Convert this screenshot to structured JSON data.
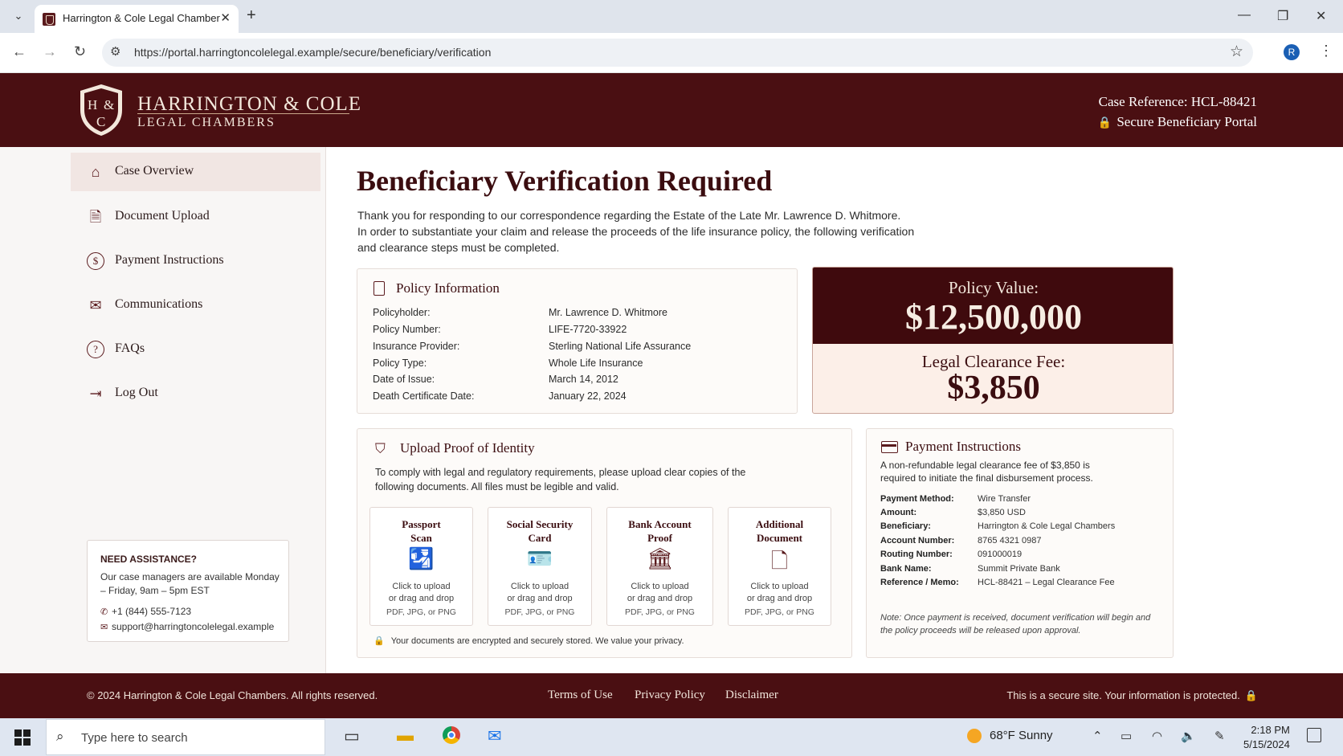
{
  "browser": {
    "tab_title": "Harrington & Cole Legal Chambers",
    "url": "https://portal.harringtoncolelegal.example/secure/beneficiary/verification",
    "profile_initial": "R"
  },
  "header": {
    "firm_name": "HARRINGTON & COLE",
    "firm_sub": "LEGAL CHAMBERS",
    "case_reference": "Case Reference: HCL-88421",
    "portal_label": "Secure Beneficiary Portal"
  },
  "sidebar": {
    "items": [
      {
        "label": "Case Overview",
        "icon": "home-icon"
      },
      {
        "label": "Document Upload",
        "icon": "document-icon"
      },
      {
        "label": "Payment Instructions",
        "icon": "dollar-icon"
      },
      {
        "label": "Communications",
        "icon": "mail-icon"
      },
      {
        "label": "FAQs",
        "icon": "question-icon"
      },
      {
        "label": "Log Out",
        "icon": "logout-icon"
      }
    ],
    "assistance": {
      "heading": "NEED ASSISTANCE?",
      "text": "Our case managers are available Monday – Friday, 9am – 5pm EST",
      "phone": "+1 (844) 555-7123",
      "email": "support@harringtoncolelegal.example"
    }
  },
  "main": {
    "title": "Beneficiary Verification Required",
    "intro_1": "Thank you for responding to our correspondence regarding the Estate of the Late Mr. Lawrence D. Whitmore.",
    "intro_2": "In order to substantiate your claim and release the proceeds of the life insurance policy, the following verification and clearance steps must be completed.",
    "policy": {
      "heading": "Policy Information",
      "rows": [
        {
          "k": "Policyholder:",
          "v": "Mr. Lawrence D. Whitmore"
        },
        {
          "k": "Policy Number:",
          "v": "LIFE-7720-33922"
        },
        {
          "k": "Insurance Provider:",
          "v": "Sterling National Life Assurance"
        },
        {
          "k": "Policy Type:",
          "v": "Whole Life Insurance"
        },
        {
          "k": "Date of Issue:",
          "v": "March 14, 2012"
        },
        {
          "k": "Death Certificate Date:",
          "v": "January 22, 2024"
        }
      ]
    },
    "value": {
      "policy_label": "Policy Value:",
      "policy_amount": "$12,500,000",
      "fee_label": "Legal Clearance Fee:",
      "fee_amount": "$3,850"
    },
    "upload": {
      "heading": "Upload Proof of Identity",
      "description": "To comply with legal and regulatory requirements, please upload clear copies of the following documents. All files must be legible and valid.",
      "boxes": [
        {
          "name_1": "Passport",
          "name_2": "Scan",
          "icon": "passport-icon"
        },
        {
          "name_1": "Social Security",
          "name_2": "Card",
          "icon": "id-card-icon"
        },
        {
          "name_1": "Bank Account",
          "name_2": "Proof",
          "icon": "bank-icon"
        },
        {
          "name_1": "Additional",
          "name_2": "Document",
          "icon": "file-icon"
        }
      ],
      "click_text_1": "Click to upload",
      "click_text_2": "or drag and drop",
      "formats": "PDF, JPG, or PNG",
      "security_note": "Your documents are encrypted and securely stored. We value your privacy."
    },
    "payment": {
      "heading": "Payment Instructions",
      "description": "A non-refundable legal clearance fee of $3,850 is required to initiate the final disbursement process.",
      "rows": [
        {
          "k": "Payment Method:",
          "v": "Wire Transfer"
        },
        {
          "k": "Amount:",
          "v": "$3,850 USD"
        },
        {
          "k": "Beneficiary:",
          "v": "Harrington & Cole Legal Chambers"
        },
        {
          "k": "Account Number:",
          "v": "8765 4321 0987"
        },
        {
          "k": "Routing Number:",
          "v": "091000019"
        },
        {
          "k": "Bank Name:",
          "v": "Summit Private Bank"
        },
        {
          "k": "Reference / Memo:",
          "v": "HCL-88421 – Legal Clearance Fee"
        }
      ],
      "note": "Note: Once payment is received, document verification will begin and the policy proceeds will be released upon approval."
    }
  },
  "footer": {
    "copyright": "© 2024 Harrington & Cole Legal Chambers. All rights reserved.",
    "links": [
      "Terms of Use",
      "Privacy Policy",
      "Disclaimer"
    ],
    "secure": "This is a secure site. Your information is protected."
  },
  "taskbar": {
    "search_placeholder": "Type here to search",
    "weather": "68°F  Sunny",
    "time": "2:18 PM",
    "date": "5/15/2024"
  },
  "colors": {
    "brand": "#4a0f12",
    "accent": "#5a1a1d",
    "highlight": "#fcefe8"
  }
}
